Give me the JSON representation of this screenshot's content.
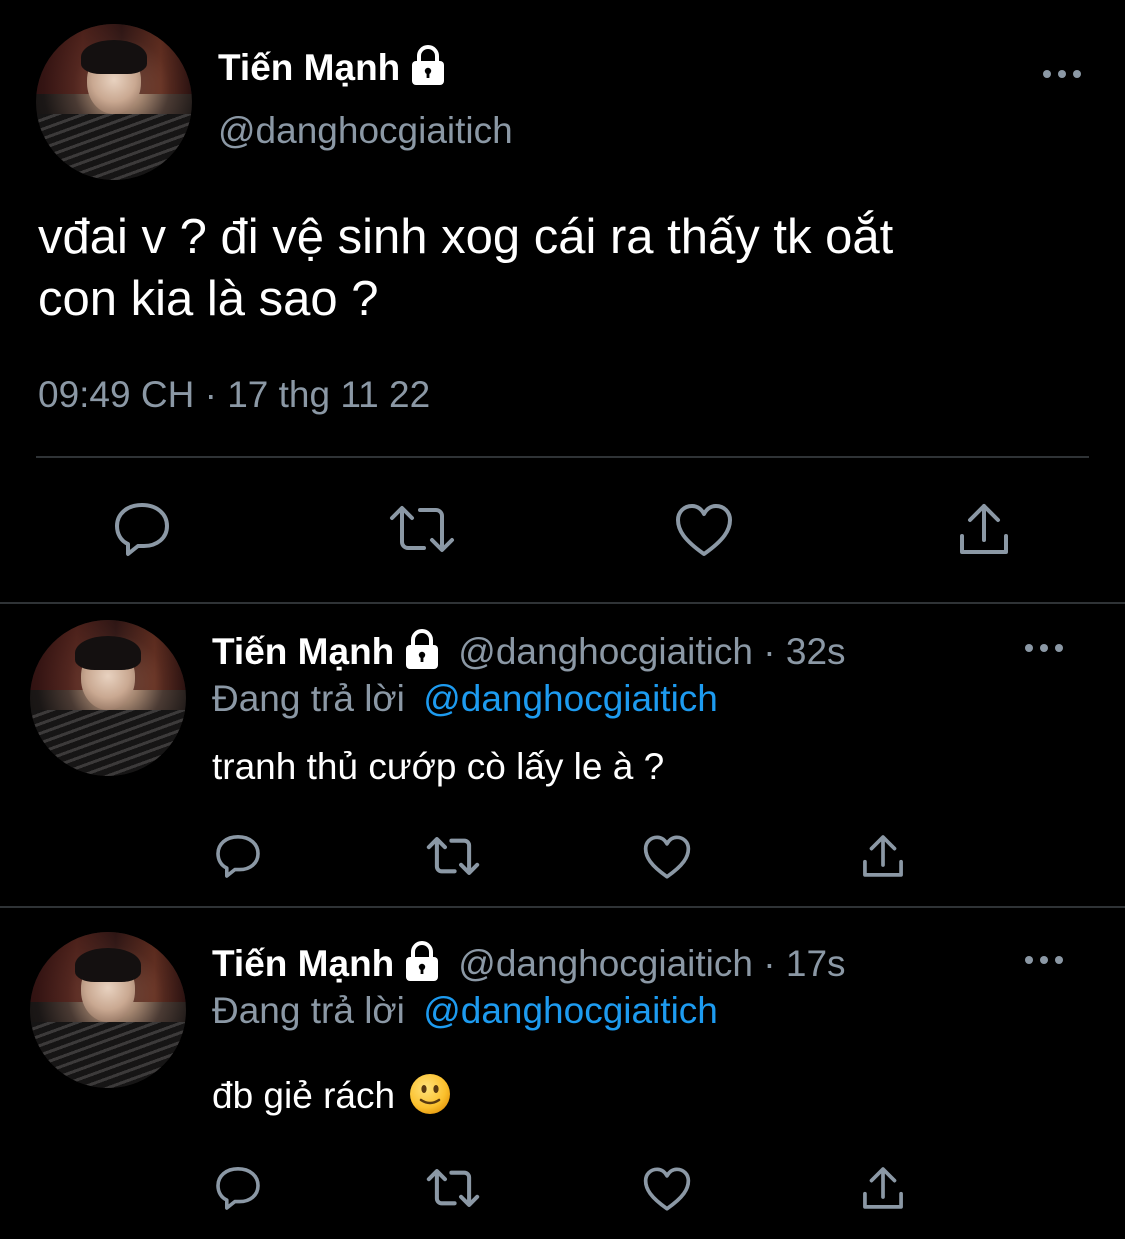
{
  "colors": {
    "background": "#000000",
    "text": "#ffffff",
    "secondary": "#8b98a5",
    "link": "#1d9bf0",
    "divider": "#2f3336"
  },
  "main_tweet": {
    "display_name": "Tiến Mạnh",
    "handle": "@danghocgiaitich",
    "text_line1": "vđai v ? đi vệ sinh xog cái ra thấy tk oắt",
    "text_line2": "con kia là sao ?",
    "timestamp": "09:49 CH · 17 thg 11 22",
    "icons": [
      "lock-icon",
      "more-icon",
      "reply-icon",
      "retweet-icon",
      "like-icon",
      "share-icon"
    ]
  },
  "replies": [
    {
      "display_name": "Tiến Mạnh",
      "handle_time": "@danghocgiaitich · 32s",
      "replying_prefix": "Đang trả lời",
      "replying_to": "@danghocgiaitich",
      "text": "tranh thủ cướp cò lấy le à ?"
    },
    {
      "display_name": "Tiến Mạnh",
      "handle_time": "@danghocgiaitich · 17s",
      "replying_prefix": "Đang trả lời",
      "replying_to": "@danghocgiaitich",
      "text": "đb giẻ rách",
      "emoji": "slightly-smiling-face-emoji"
    }
  ]
}
